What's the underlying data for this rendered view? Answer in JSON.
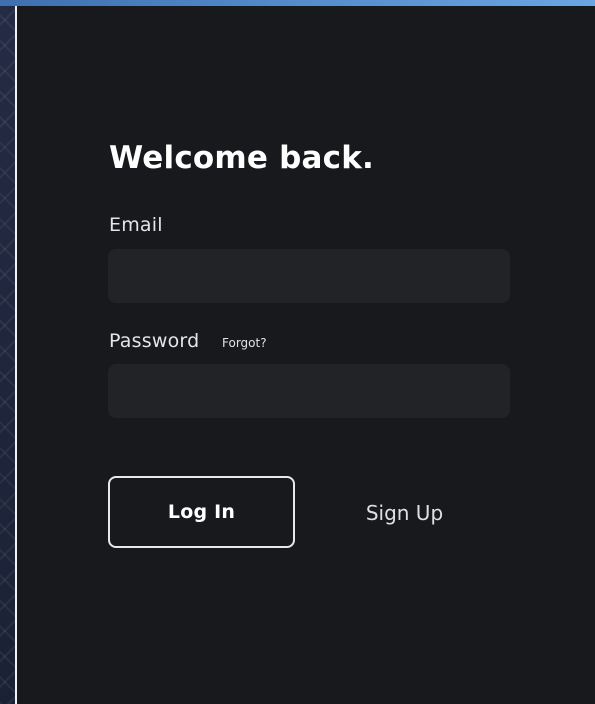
{
  "form": {
    "title": "Welcome back.",
    "email_label": "Email",
    "email_value": "",
    "password_label": "Password",
    "password_value": "",
    "forgot_link": "Forgot?",
    "login_button": "Log In",
    "signup_button": "Sign Up"
  },
  "colors": {
    "panel_bg": "#18191c",
    "input_bg": "#222327",
    "text_primary": "#ffffff",
    "button_border": "#e8e8e8",
    "backdrop": "#1e2438",
    "accent_strip": "#4f86c8"
  }
}
